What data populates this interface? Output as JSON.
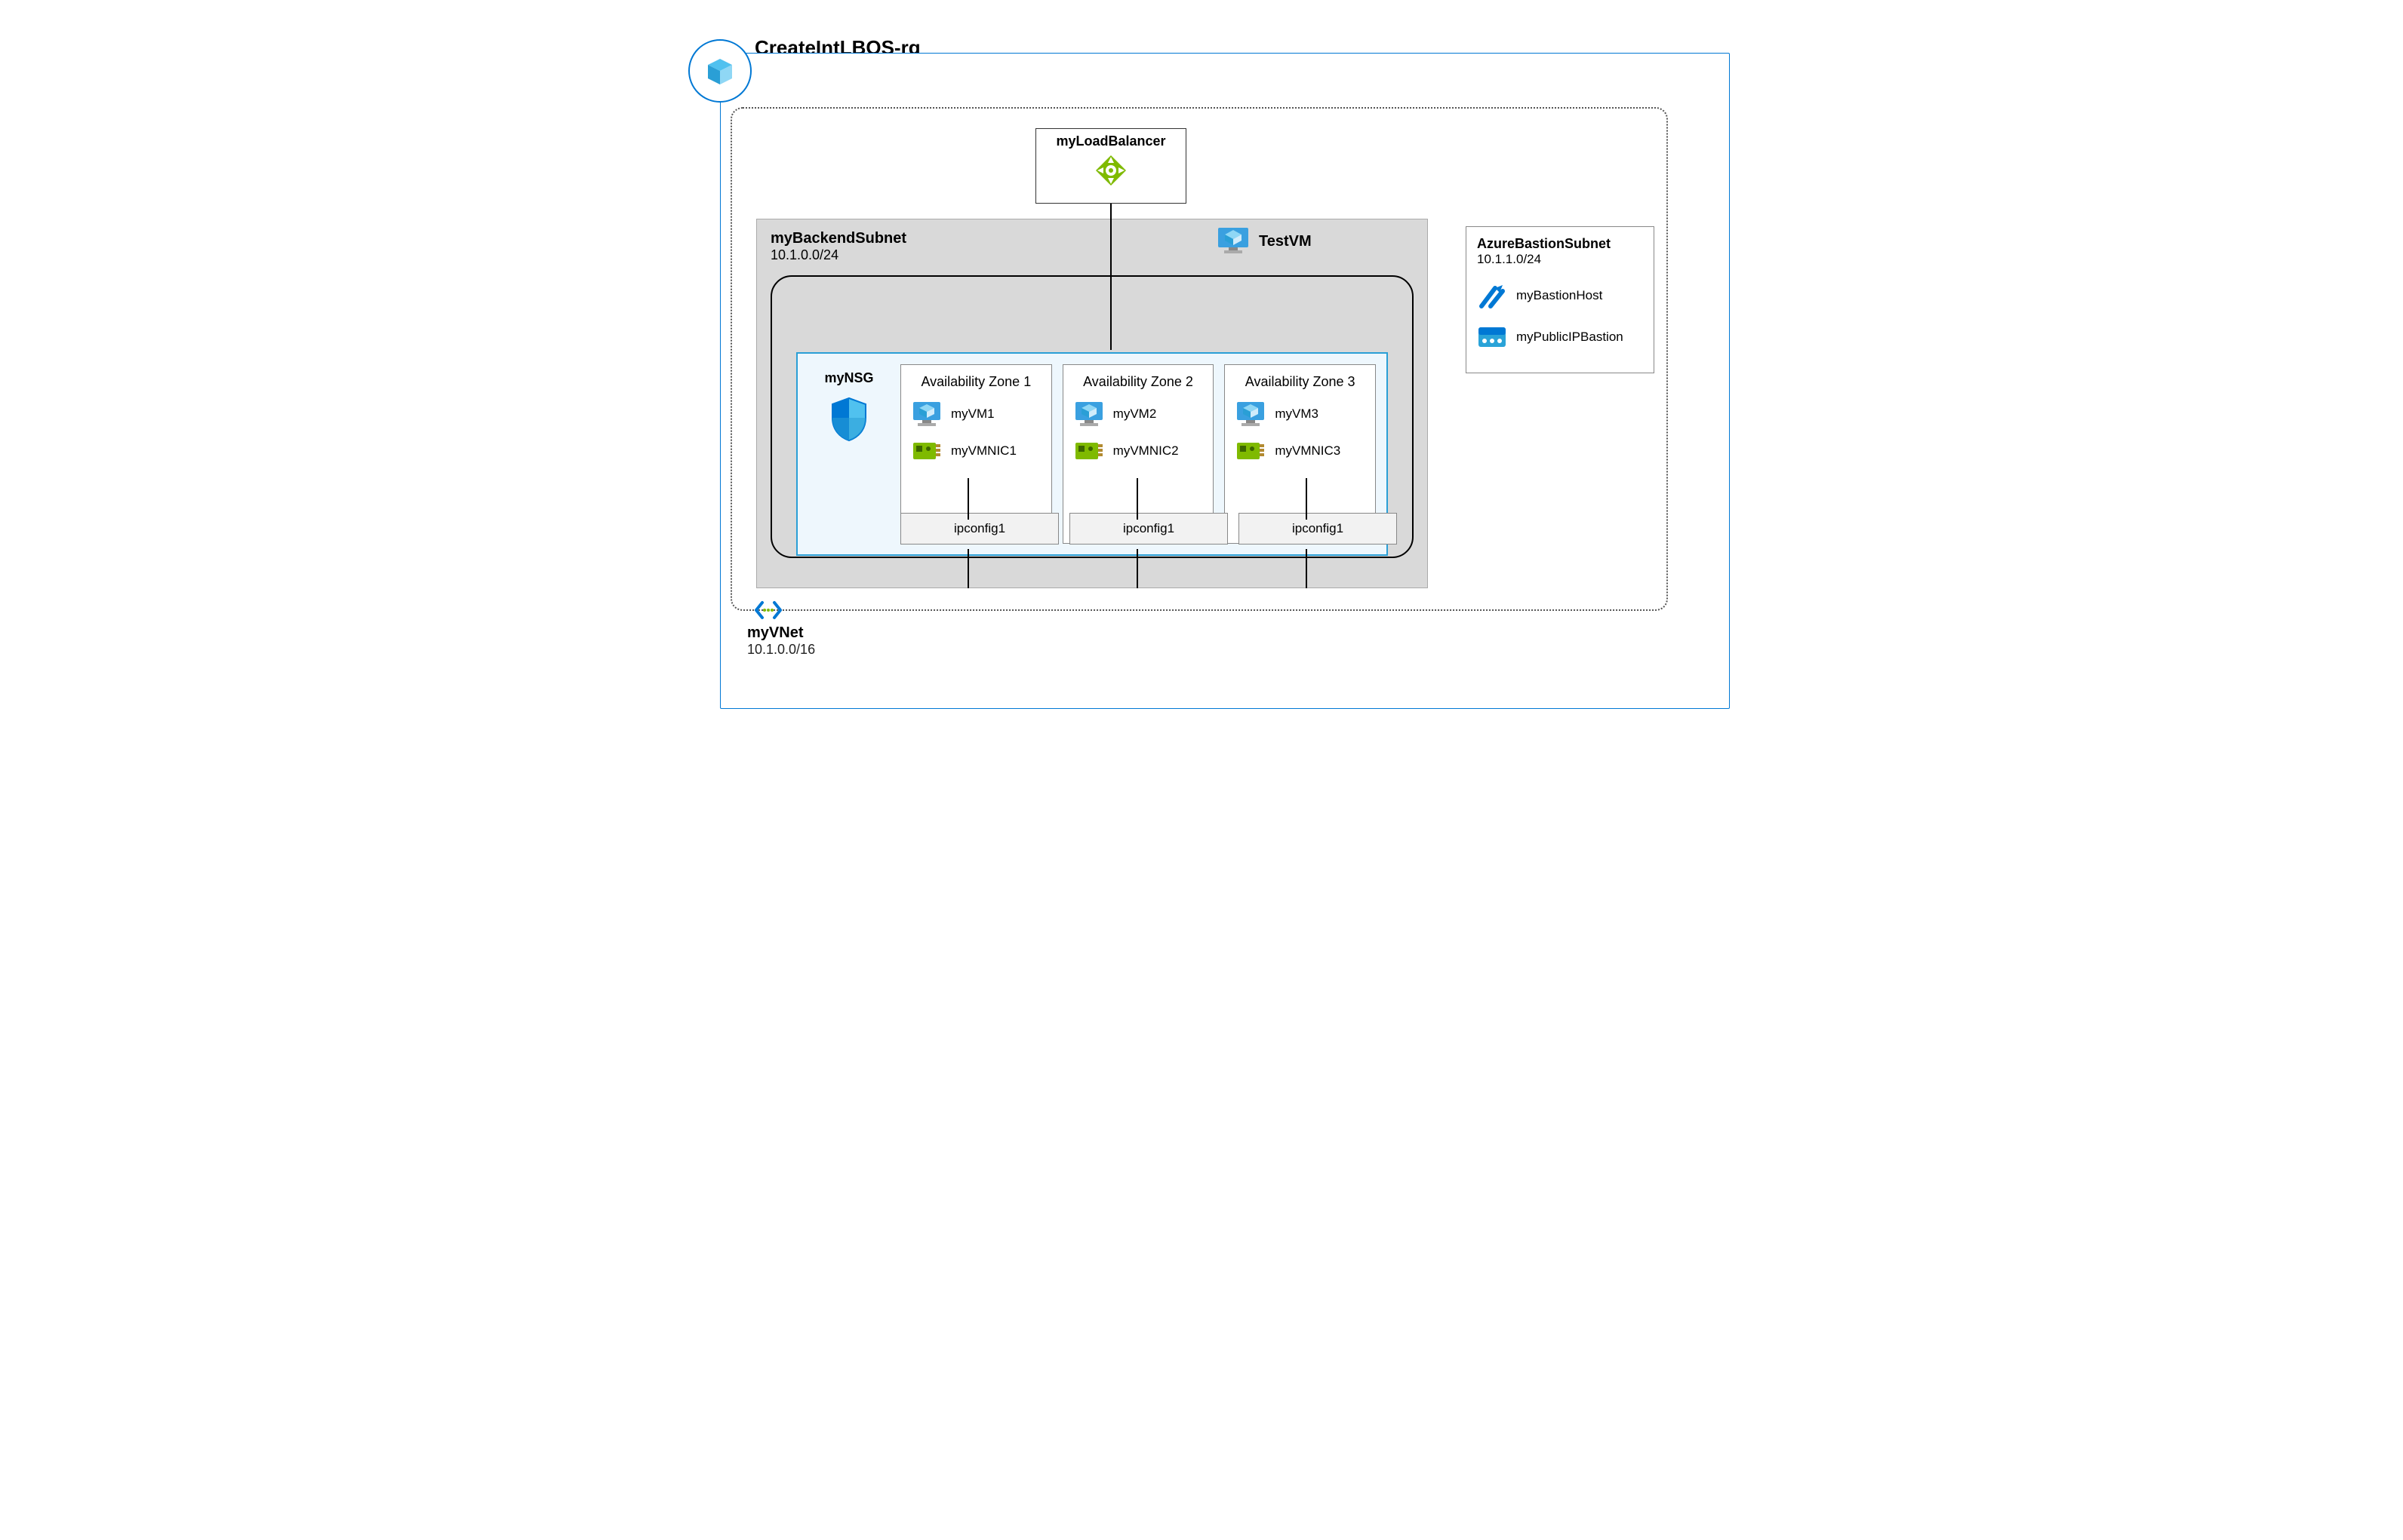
{
  "resource_group": {
    "name": "CreateIntLBQS-rg"
  },
  "vnet": {
    "name": "myVNet",
    "cidr": "10.1.0.0/16"
  },
  "load_balancer": {
    "name": "myLoadBalancer"
  },
  "backend_subnet": {
    "name": "myBackendSubnet",
    "cidr": "10.1.0.0/24"
  },
  "test_vm": {
    "name": "TestVM"
  },
  "nsg": {
    "name": "myNSG"
  },
  "zones": [
    {
      "title": "Availability Zone 1",
      "vm": "myVM1",
      "nic": "myVMNIC1",
      "ipconfig": "ipconfig1"
    },
    {
      "title": "Availability Zone 2",
      "vm": "myVM2",
      "nic": "myVMNIC2",
      "ipconfig": "ipconfig1"
    },
    {
      "title": "Availability Zone 3",
      "vm": "myVM3",
      "nic": "myVMNIC3",
      "ipconfig": "ipconfig1"
    }
  ],
  "bastion_subnet": {
    "name": "AzureBastionSubnet",
    "cidr": "10.1.1.0/24",
    "host": "myBastionHost",
    "pip": "myPublicIPBastion"
  },
  "colors": {
    "azure_blue": "#0078d4",
    "light_blue_bg": "#eef7fd",
    "subnet_gray": "#d9d9d9",
    "lb_green": "#7fba00"
  }
}
